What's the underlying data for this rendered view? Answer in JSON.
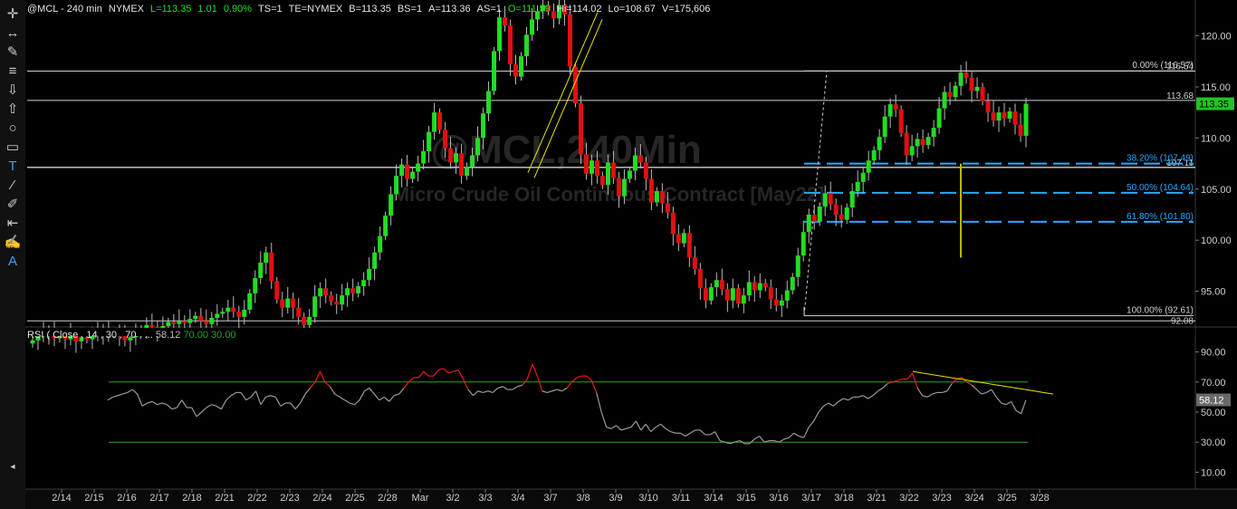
{
  "header": {
    "symbol": "@MCL - 240 min",
    "exchange": "NYMEX",
    "last": "L=113.35",
    "change": "1.01",
    "change_pct": "0.90%",
    "ts": "TS=1",
    "te": "TE=NYMEX",
    "bid": "B=113.35",
    "bid_size": "BS=1",
    "ask": "A=113.36",
    "ask_size": "AS=1",
    "open": "O=111.59",
    "high": "Hi=114.02",
    "low": "Lo=108.67",
    "volume": "V=175,606"
  },
  "watermark": {
    "title": "@MCL,240Min",
    "subtitle": "Micro Crude Oil Continuous Contract [May22]"
  },
  "colors": {
    "up": "#22dd22",
    "down": "#e01010",
    "fib": "#29a9ff",
    "rsi_line": "#9a9a9a",
    "rsi_hot": "#ee1a1a",
    "rsi_bands": "#2ca02c",
    "trend": "#e8e800",
    "last_badge": "#22c322"
  },
  "toolbar": {
    "tools": [
      "crosshair-icon",
      "pan-icon",
      "pencil-icon",
      "list-icon",
      "arrow-down-icon",
      "arrow-up-icon",
      "ellipse-icon",
      "rectangle-icon",
      "text-icon",
      "trendline-icon",
      "paint-icon",
      "cursor-icon",
      "brush-icon",
      "annotation-icon"
    ]
  },
  "chart_data": [
    {
      "type": "candlestick",
      "title": "@MCL,240Min",
      "subtitle": "Micro Crude Oil Continuous Contract [May22]",
      "ylim": [
        91.6,
        123.5
      ],
      "y_ticks": [
        "120.00",
        "115.00",
        "110.00",
        "105.00",
        "100.00",
        "95.00"
      ],
      "x_ticks": [
        "2/14",
        "2/15",
        "2/16",
        "2/17",
        "2/18",
        "2/21",
        "2/22",
        "2/23",
        "2/24",
        "2/25",
        "2/28",
        "Mar",
        "3/2",
        "3/3",
        "3/4",
        "3/7",
        "3/8",
        "3/9",
        "3/10",
        "3/11",
        "3/14",
        "3/15",
        "3/16",
        "3/17",
        "3/18",
        "3/21",
        "3/22",
        "3/23",
        "3/24",
        "3/25",
        "3/28"
      ],
      "last_price": "113.35",
      "levels": [
        {
          "label": "116.54",
          "value": 116.54
        },
        {
          "label": "113.68",
          "value": 113.68
        },
        {
          "label": "107.11",
          "value": 107.11
        }
      ],
      "fib_levels": [
        {
          "label": "0.00% (116.57)",
          "value": 116.57
        },
        {
          "label": "38.20% (107.49)",
          "value": 107.49
        },
        {
          "label": "50.00% (104.64)",
          "value": 104.64
        },
        {
          "label": "61.80% (101.80)",
          "value": 101.8
        },
        {
          "label": "100.00% (92.61)",
          "value": 92.61
        }
      ],
      "low_marker": "92.08",
      "closes": [
        90.2,
        90.6,
        90.9,
        91.1,
        90.4,
        90.6,
        90.3,
        90.8,
        90.1,
        90.5,
        90.3,
        90.7,
        90.9,
        91.2,
        90.8,
        91.0,
        90.6,
        90.2,
        90.5,
        90.9,
        91.3,
        91.7,
        91.5,
        91.2,
        91.6,
        92.0,
        91.8,
        92.1,
        91.9,
        92.3,
        92.6,
        92.1,
        91.8,
        92.4,
        92.8,
        93.0,
        93.4,
        93.0,
        92.5,
        93.2,
        94.8,
        96.3,
        97.8,
        98.8,
        96.0,
        94.2,
        93.4,
        94.3,
        93.4,
        92.5,
        91.7,
        92.5,
        94.5,
        95.3,
        94.6,
        94.0,
        93.7,
        94.6,
        95.3,
        94.8,
        95.5,
        96.1,
        97.2,
        98.8,
        100.4,
        102.4,
        104.5,
        106.3,
        107.4,
        106.0,
        106.7,
        107.5,
        108.7,
        110.6,
        112.5,
        110.8,
        109.0,
        107.6,
        108.5,
        106.3,
        107.2,
        108.3,
        110.0,
        112.4,
        114.6,
        118.5,
        121.8,
        121.0,
        117.2,
        116.0,
        118.0,
        120.1,
        121.6,
        122.4,
        123.0,
        122.4,
        121.7,
        123.0,
        122.1,
        117.0,
        113.4,
        108.4,
        106.5,
        107.8,
        106.3,
        105.4,
        107.6,
        106.1,
        104.3,
        106.0,
        106.8,
        108.3,
        107.6,
        106.0,
        103.7,
        104.8,
        103.6,
        102.7,
        100.6,
        99.7,
        100.7,
        98.3,
        97.2,
        95.3,
        94.1,
        95.4,
        96.1,
        95.2,
        94.1,
        95.3,
        93.8,
        94.6,
        95.9,
        95.1,
        95.8,
        95.4,
        94.2,
        93.6,
        94.1,
        95.1,
        96.4,
        98.5,
        100.8,
        102.5,
        101.8,
        103.3,
        104.6,
        103.5,
        102.5,
        102.0,
        103.2,
        104.8,
        105.7,
        106.6,
        107.8,
        108.8,
        110.1,
        112.1,
        113.3,
        112.8,
        110.5,
        108.3,
        109.2,
        109.9,
        109.3,
        110.1,
        111.0,
        112.9,
        114.5,
        114.0,
        115.1,
        116.4,
        115.9,
        114.6,
        115.0,
        113.6,
        112.5,
        111.7,
        112.5,
        111.9,
        112.6,
        111.3,
        110.2,
        113.35
      ]
    },
    {
      "type": "line",
      "title": "RSI ( Close , 14 , 30 , 70 , ...",
      "last": "58.12",
      "overbought": "70.00",
      "oversold": "30.00",
      "ylim": [
        0,
        100
      ],
      "y_ticks": [
        "90.00",
        "70.00",
        "50.00",
        "30.00",
        "10.00"
      ],
      "values": [
        58,
        60,
        61,
        62,
        63,
        65,
        62,
        54,
        56,
        57,
        55,
        56,
        55,
        52,
        53,
        58,
        53,
        53,
        47,
        50,
        53,
        55,
        54,
        52,
        58,
        61,
        63,
        63,
        58,
        60,
        64,
        55,
        60,
        61,
        60,
        54,
        56,
        56,
        52,
        56,
        62,
        66,
        70,
        77,
        70,
        67,
        62,
        60,
        58,
        56,
        55,
        58,
        64,
        66,
        62,
        58,
        60,
        57,
        61,
        62,
        66,
        70,
        73,
        73,
        77,
        74,
        74,
        78,
        79,
        76,
        77,
        78,
        72,
        65,
        61,
        64,
        63,
        64,
        63,
        66,
        67,
        65,
        65,
        67,
        68,
        72,
        82,
        74,
        64,
        63,
        64,
        65,
        64,
        66,
        70,
        73,
        74,
        74,
        71,
        63,
        50,
        40,
        39,
        41,
        38,
        39,
        40,
        44,
        38,
        42,
        37,
        40,
        42,
        39,
        37,
        36,
        36,
        34,
        36,
        38,
        38,
        35,
        35,
        37,
        31,
        30,
        29,
        30,
        31,
        29,
        29,
        32,
        34,
        30,
        31,
        31,
        30,
        32,
        33,
        36,
        34,
        33,
        40,
        44,
        50,
        54,
        56,
        54,
        57,
        59,
        58,
        60,
        60,
        61,
        59,
        61,
        64,
        66,
        69,
        70,
        71,
        72,
        72,
        76,
        66,
        61,
        60,
        62,
        63,
        63,
        64,
        69,
        72,
        73,
        70,
        68,
        65,
        62,
        63,
        65,
        60,
        56,
        55,
        57,
        51,
        49,
        58
      ]
    }
  ]
}
